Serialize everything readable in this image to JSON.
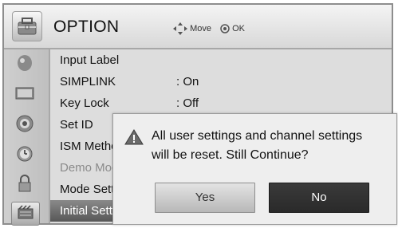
{
  "header": {
    "title": "OPTION",
    "move_hint": "Move",
    "ok_hint": "OK"
  },
  "menu_items": [
    {
      "label": "Input Label",
      "value": ""
    },
    {
      "label": "SIMPLINK",
      "value": ": On"
    },
    {
      "label": "Key Lock",
      "value": ": Off"
    },
    {
      "label": "Set ID",
      "value": ""
    },
    {
      "label": "ISM Metho",
      "value": ""
    },
    {
      "label": "Demo Moc",
      "value": ""
    },
    {
      "label": "Mode Sett",
      "value": ""
    },
    {
      "label": "Initial Sett",
      "value": ""
    }
  ],
  "sidebar_icons": [
    "picture-icon",
    "screen-icon",
    "audio-icon",
    "clock-icon",
    "lock-icon",
    "option-icon"
  ],
  "dialog": {
    "line1": "All user settings and channel settings",
    "line2": "will be reset. Still Continue?",
    "yes_label": "Yes",
    "no_label": "No"
  },
  "colors": {
    "selected_row": "#6e6e6e",
    "no_button": "#303030",
    "warning": "#6a6a6a"
  }
}
